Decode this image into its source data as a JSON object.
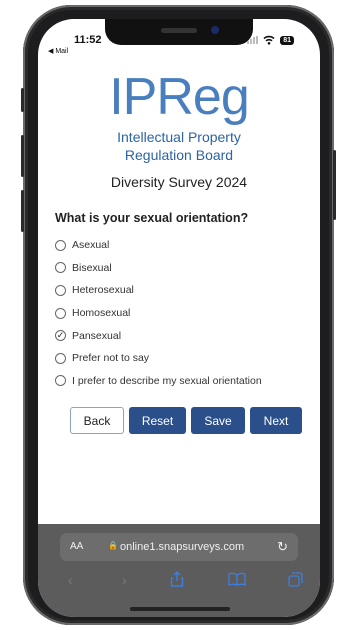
{
  "status": {
    "time": "11:52",
    "back_label": "◀ Mail",
    "battery": "81"
  },
  "logo": {
    "main": "IPReg",
    "line1": "Intellectual Property",
    "line2": "Regulation Board"
  },
  "survey_title": "Diversity Survey 2024",
  "question": "What is your sexual orientation?",
  "options": [
    {
      "label": "Asexual",
      "selected": false
    },
    {
      "label": "Bisexual",
      "selected": false
    },
    {
      "label": "Heterosexual",
      "selected": false
    },
    {
      "label": "Homosexual",
      "selected": false
    },
    {
      "label": "Pansexual",
      "selected": true
    },
    {
      "label": "Prefer not to say",
      "selected": false
    },
    {
      "label": "I prefer to describe my sexual orientation",
      "selected": false
    }
  ],
  "buttons": {
    "back": "Back",
    "reset": "Reset",
    "save": "Save",
    "next": "Next"
  },
  "browser": {
    "aa": "AA",
    "url": "online1.snapsurveys.com"
  },
  "colors": {
    "primary_button": "#2a4f8a",
    "logo_blue": "#4a7fbf",
    "browser_bar": "#5c5c5c"
  }
}
